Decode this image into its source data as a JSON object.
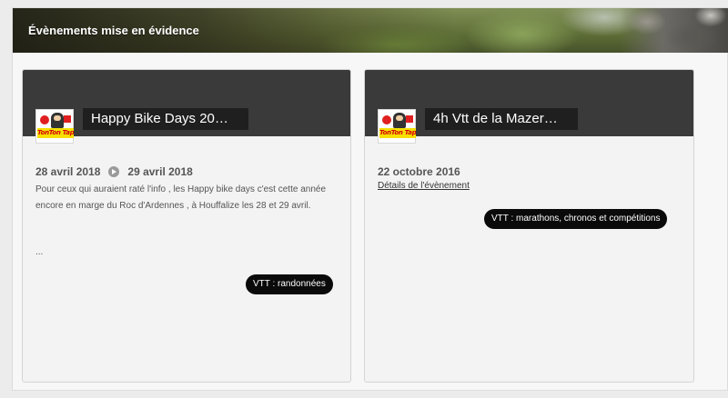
{
  "section": {
    "title": "Évènements mise en évidence"
  },
  "cards": [
    {
      "title": "Happy Bike Days 20…",
      "logo_text": "TonTon Tapis",
      "date_start": "28 avril 2018",
      "date_end": "29 avril 2018",
      "description": "Pour ceux qui auraient raté l'info , les Happy bike days c'est cette année encore en marge du Roc d'Ardennes , à Houffalize les 28 et 29 avril.",
      "ellipsis": "...",
      "tag": "VTT : randonnées"
    },
    {
      "title": "4h Vtt de la Mazer…",
      "logo_text": "TonTon Tapis",
      "date": "22 octobre 2016",
      "details_link": "Détails de l'évènement",
      "tag": "VTT : marathons, chronos et compétitions"
    }
  ],
  "colors": {
    "card_header": "#3a3a3a",
    "title_box": "#1f1f1f",
    "tag_bg": "#0a0a0a",
    "logo_red": "#e02020",
    "logo_yellow": "#f6e000"
  },
  "icons": {
    "date_separator": "arrow-circle-right-icon"
  }
}
